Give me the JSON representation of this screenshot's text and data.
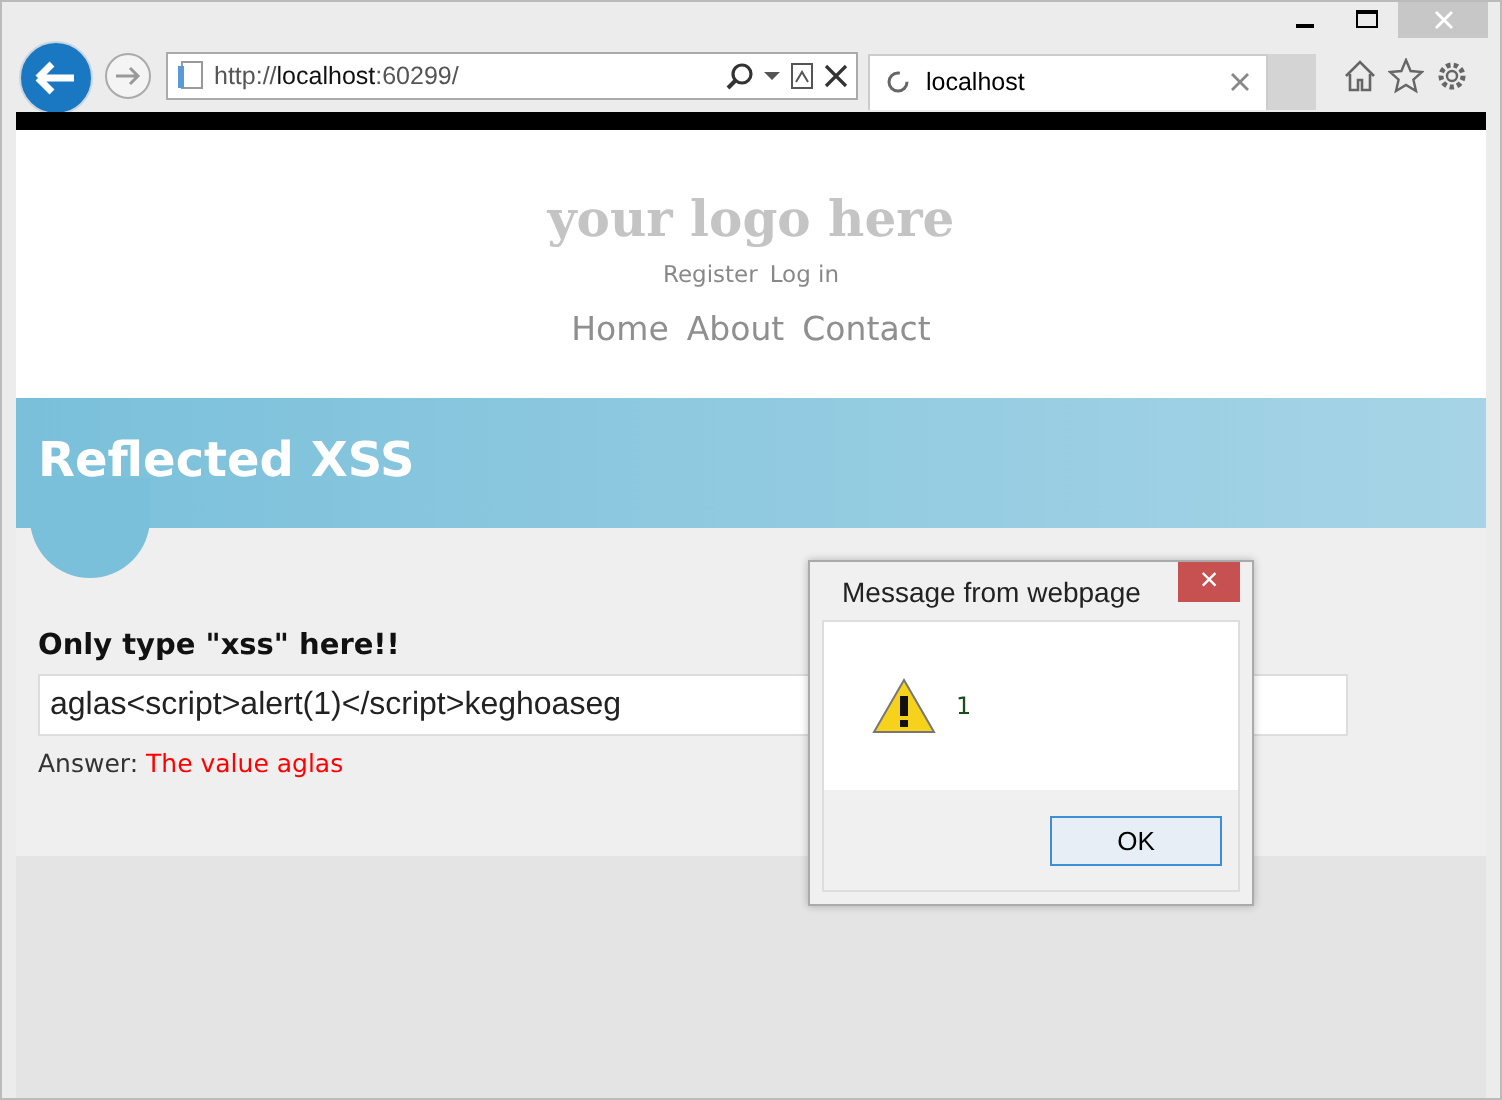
{
  "browser": {
    "address": "http://**localhost**:60299/",
    "tab": {
      "title": "localhost",
      "selected": true
    }
  },
  "site": {
    "logo": "your logo here",
    "account_links": [
      "Register",
      "Log in"
    ],
    "nav": [
      "Home",
      "About",
      "Contact"
    ]
  },
  "banner": {
    "title": "Reflected XSS"
  },
  "form": {
    "label": "Only type \"xss\" here!!",
    "value": "aglas<script>alert(1)</script>keghoaseg",
    "answer_label": "Answer:",
    "answer": "The value aglas"
  },
  "dialog": {
    "title": "Message from webpage",
    "close": "×",
    "message": "1",
    "button": "OK"
  }
}
